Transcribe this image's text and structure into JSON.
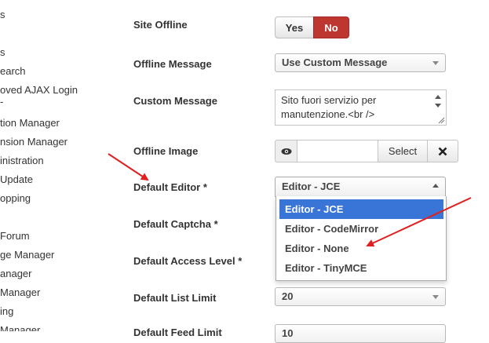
{
  "sidebar": {
    "items": [
      {
        "label": "s",
        "left": 0
      },
      {
        "label": "s",
        "left": 0
      },
      {
        "label": "earch",
        "left": 0
      },
      {
        "label": "oved AJAX Login",
        "left": 0
      },
      {
        "label": "-",
        "left": 0
      },
      {
        "label": "tion Manager",
        "left": 0
      },
      {
        "label": "nsion Manager",
        "left": 0
      },
      {
        "label": "inistration",
        "left": 0
      },
      {
        "label": " Update",
        "left": 0
      },
      {
        "label": "opping",
        "left": 0
      },
      {
        "label": " Forum",
        "left": 0
      },
      {
        "label": "ge Manager",
        "left": 0
      },
      {
        "label": "anager",
        "left": 0
      },
      {
        "label": "Manager",
        "left": 0
      },
      {
        "label": "ing",
        "left": 0
      },
      {
        "label": " Manager",
        "left": 0
      }
    ]
  },
  "fields": {
    "site_offline": {
      "label": "Site Offline",
      "yes": "Yes",
      "no": "No"
    },
    "offline_message": {
      "label": "Offline Message",
      "value": "Use Custom Message"
    },
    "custom_message": {
      "label": "Custom Message",
      "line1": "Sito fuori servizio per",
      "line2": "manutenzione.<br />"
    },
    "offline_image": {
      "label": "Offline Image",
      "select": "Select"
    },
    "default_editor": {
      "label": "Default Editor *",
      "value": "Editor - JCE"
    },
    "default_captcha": {
      "label": "Default Captcha *"
    },
    "default_access": {
      "label": "Default Access Level *"
    },
    "default_list_limit": {
      "label": "Default List Limit",
      "value": "20"
    },
    "next_label": {
      "label": "Default Feed Limit",
      "value": "10"
    }
  },
  "editor_options": [
    "Editor - JCE",
    "Editor - CodeMirror",
    "Editor - None",
    "Editor - TinyMCE"
  ],
  "colors": {
    "accent": "#3875d7",
    "no_button": "#bd362f",
    "arrow": "#e02020"
  }
}
